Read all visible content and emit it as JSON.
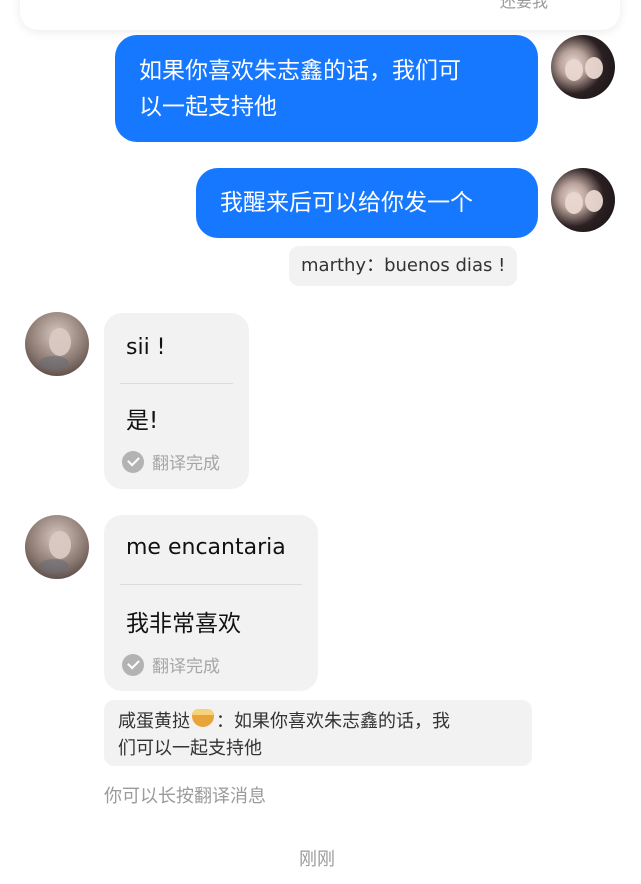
{
  "top_card": {
    "label": "还要我"
  },
  "messages": {
    "m1": {
      "text_line1": "如果你喜欢朱志鑫的话，我们可",
      "text_line2": "以一起支持他"
    },
    "m2": {
      "text": "我醒来后可以给你发一个"
    },
    "sys1": {
      "text": "marthy：buenos dias !"
    },
    "t1": {
      "original": "sii !",
      "translated": "是!",
      "status": "翻译完成"
    },
    "t2": {
      "original": "me encantaria",
      "translated": "我非常喜欢",
      "status": "翻译完成"
    },
    "quote": {
      "sender": "咸蛋黄挞",
      "text_part1": "：如果你喜欢朱志鑫的话，我",
      "text_part2": "们可以一起支持他"
    }
  },
  "hint": "你可以长按翻译消息",
  "timestamp": "刚刚",
  "colors": {
    "accent_blue": "#1677ff",
    "bubble_gray": "#f2f2f2"
  },
  "icons": {
    "check": "check-circle-icon",
    "egg_tart": "egg-tart-icon"
  }
}
